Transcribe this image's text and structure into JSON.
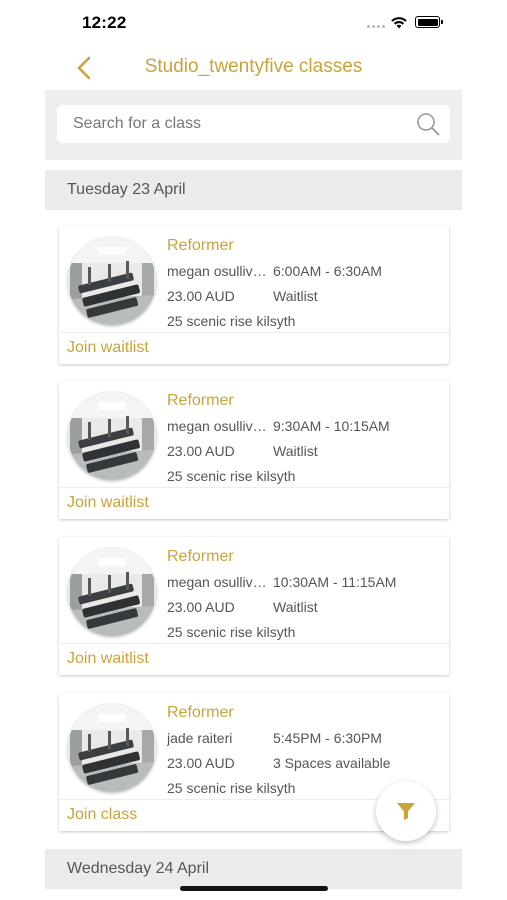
{
  "status_bar": {
    "time": "12:22"
  },
  "nav": {
    "title": "Studio_twentyfive classes"
  },
  "search": {
    "placeholder": "Search for a class"
  },
  "days": [
    {
      "label": "Tuesday 23 April"
    },
    {
      "label": "Wednesday 24 April"
    }
  ],
  "classes": [
    {
      "title": "Reformer",
      "instructor": "megan osullivan",
      "time": "6:00AM - 6:30AM",
      "price": "23.00 AUD",
      "status": "Waitlist",
      "location": "25 scenic rise kilsyth",
      "action": "Join waitlist"
    },
    {
      "title": "Reformer",
      "instructor": "megan osullivan",
      "time": "9:30AM - 10:15AM",
      "price": "23.00 AUD",
      "status": "Waitlist",
      "location": "25 scenic rise kilsyth",
      "action": "Join waitlist"
    },
    {
      "title": "Reformer",
      "instructor": "megan osullivan",
      "time": "10:30AM - 11:15AM",
      "price": "23.00 AUD",
      "status": "Waitlist",
      "location": "25 scenic rise kilsyth",
      "action": "Join waitlist"
    },
    {
      "title": "Reformer",
      "instructor": "jade raiteri",
      "time": "5:45PM - 6:30PM",
      "price": "23.00 AUD",
      "status": "3 Spaces available",
      "location": "25 scenic rise kilsyth",
      "action": "Join class"
    }
  ],
  "colors": {
    "accent": "#c9a33b",
    "header_bg": "#ebebeb",
    "text": "#555555"
  },
  "icons": {
    "back": "chevron-left-icon",
    "search": "magnifier-icon",
    "filter": "funnel-icon"
  }
}
